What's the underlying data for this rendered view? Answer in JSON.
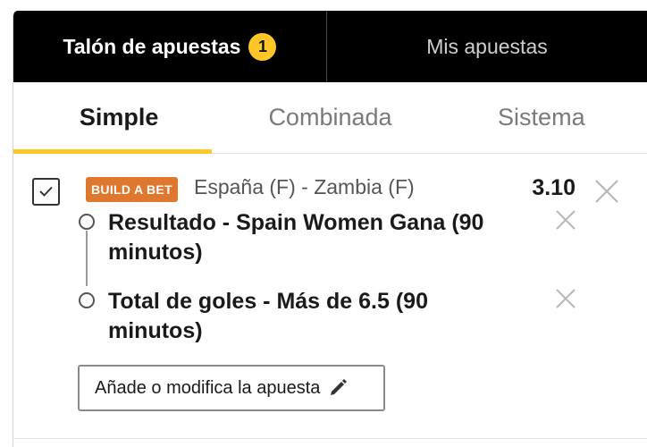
{
  "header": {
    "betslip_label": "Talón de apuestas",
    "betslip_count": "1",
    "my_bets_label": "Mis apuestas"
  },
  "bet_tabs": {
    "simple": "Simple",
    "combinada": "Combinada",
    "sistema": "Sistema",
    "active": "Simple"
  },
  "bet": {
    "badge": "BUILD A BET",
    "event": "España (F) - Zambia (F)",
    "odds": "3.10",
    "selected": true,
    "legs": [
      {
        "text": "Resultado - Spain Women Gana (90 minutos)"
      },
      {
        "text": "Total de goles - Más de 6.5 (90 minutos)"
      }
    ],
    "modify_label": "Añade o modifica la apuesta"
  },
  "colors": {
    "accent": "#ffc629",
    "badge": "#e0772e",
    "header_bg": "#000000"
  },
  "icons": {
    "checkbox": "check-icon",
    "remove": "close-icon",
    "edit": "pencil-icon"
  }
}
